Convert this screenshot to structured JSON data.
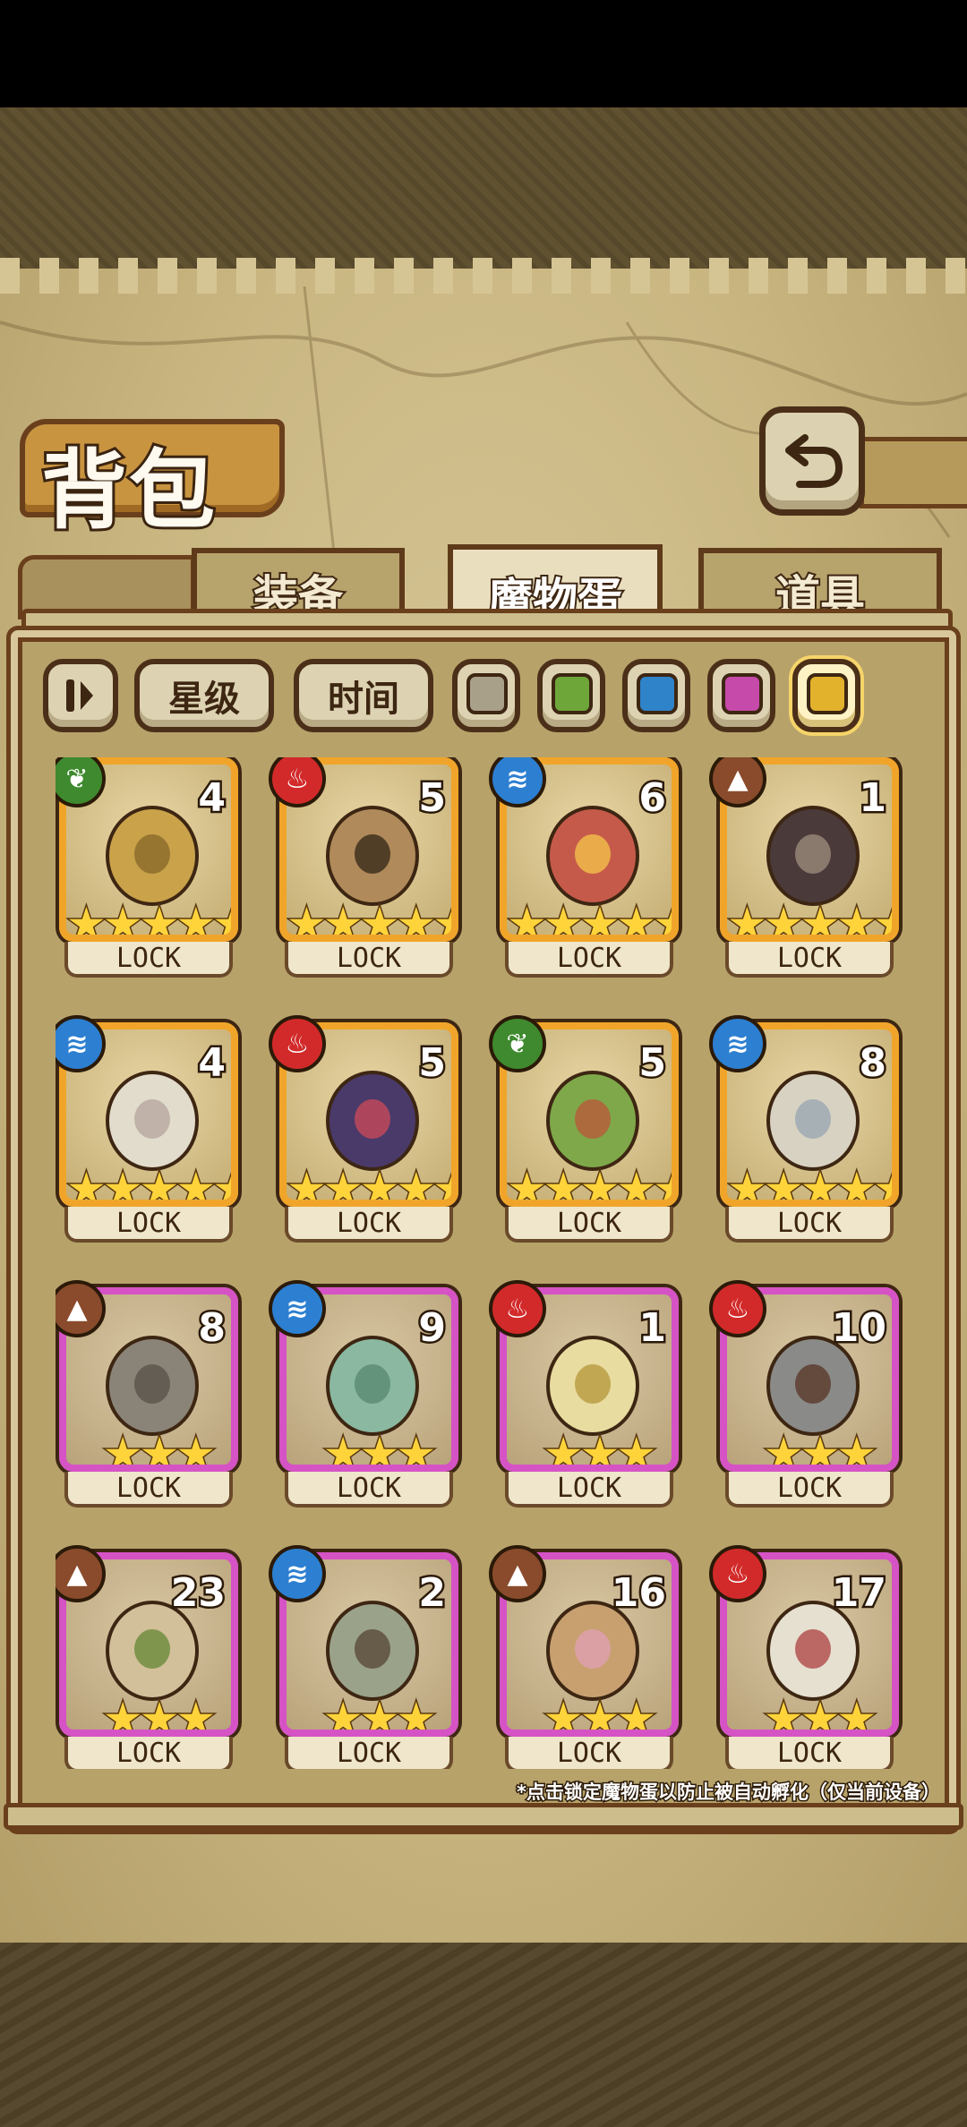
{
  "title": "背包",
  "tabs": [
    {
      "label": "装备",
      "active": false
    },
    {
      "label": "魔物蛋",
      "active": true
    },
    {
      "label": "道具",
      "active": false
    }
  ],
  "filters": {
    "sort_icon": "sort-bars-icon",
    "star_label": "星级",
    "time_label": "时间",
    "colors": [
      "#a9a08a",
      "#6ea63a",
      "#2f83c9",
      "#c64aa9",
      "#e3b22c"
    ],
    "selected_color_index": 4
  },
  "eggs": [
    {
      "element": "grass",
      "count": "4",
      "stars": 5,
      "rarity": "gold",
      "lock": "LOCK",
      "icon": "magic-lamp-icon"
    },
    {
      "element": "fire",
      "count": "5",
      "stars": 5,
      "rarity": "gold",
      "lock": "LOCK",
      "icon": "crowned-egg-icon"
    },
    {
      "element": "water",
      "count": "6",
      "stars": 5,
      "rarity": "gold",
      "lock": "LOCK",
      "icon": "eye-orb-icon"
    },
    {
      "element": "earth",
      "count": "1",
      "stars": 5,
      "rarity": "gold",
      "lock": "LOCK",
      "icon": "coffin-icon"
    },
    {
      "element": "water",
      "count": "4",
      "stars": 5,
      "rarity": "gold",
      "lock": "LOCK",
      "icon": "swirl-egg-icon"
    },
    {
      "element": "fire",
      "count": "5",
      "stars": 5,
      "rarity": "gold",
      "lock": "LOCK",
      "icon": "dark-orb-icon"
    },
    {
      "element": "grass",
      "count": "5",
      "stars": 5,
      "rarity": "gold",
      "lock": "LOCK",
      "icon": "leaf-egg-icon"
    },
    {
      "element": "water",
      "count": "8",
      "stars": 5,
      "rarity": "gold",
      "lock": "LOCK",
      "icon": "winged-egg-icon"
    },
    {
      "element": "earth",
      "count": "8",
      "stars": 3,
      "rarity": "purple",
      "lock": "LOCK",
      "icon": "sword-icon"
    },
    {
      "element": "water",
      "count": "9",
      "stars": 3,
      "rarity": "purple",
      "lock": "LOCK",
      "icon": "slime-icon"
    },
    {
      "element": "fire",
      "count": "1",
      "stars": 3,
      "rarity": "purple",
      "lock": "LOCK",
      "icon": "caged-egg-icon"
    },
    {
      "element": "fire",
      "count": "10",
      "stars": 3,
      "rarity": "purple",
      "lock": "LOCK",
      "icon": "dagger-icon"
    },
    {
      "element": "earth",
      "count": "23",
      "stars": 3,
      "rarity": "purple",
      "lock": "LOCK",
      "icon": "vine-egg-icon"
    },
    {
      "element": "water",
      "count": "2",
      "stars": 3,
      "rarity": "purple",
      "lock": "LOCK",
      "icon": "skeleton-icon"
    },
    {
      "element": "earth",
      "count": "16",
      "stars": 3,
      "rarity": "purple",
      "lock": "LOCK",
      "icon": "flower-nest-icon"
    },
    {
      "element": "fire",
      "count": "17",
      "stars": 3,
      "rarity": "purple",
      "lock": "LOCK",
      "icon": "scroll-icon"
    }
  ],
  "footnote": "*点击锁定魔物蛋以防止被自动孵化（仅当前设备）",
  "back_icon": "return-arrow-icon"
}
